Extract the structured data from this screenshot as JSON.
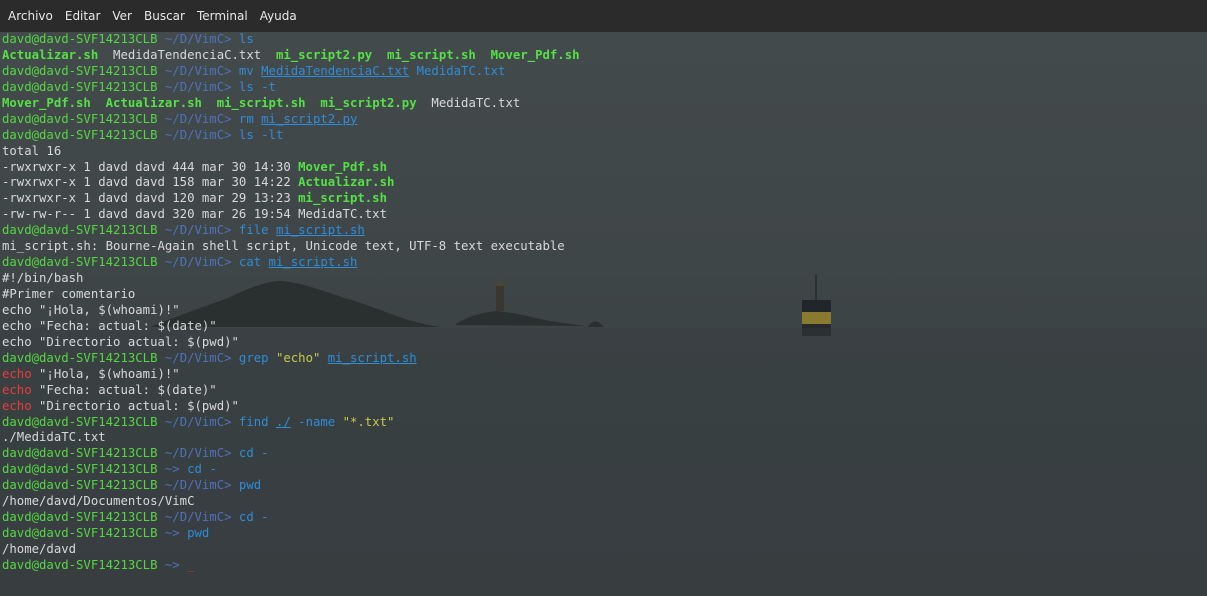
{
  "menubar": {
    "items": [
      "Archivo",
      "Editar",
      "Ver",
      "Buscar",
      "Terminal",
      "Ayuda"
    ]
  },
  "terminal": {
    "lines": [
      [
        {
          "t": "davd@davd-SVF14213CLB",
          "c": "pu"
        },
        {
          "t": " ~/D/VimC> ",
          "c": "pp"
        },
        {
          "t": "ls",
          "c": "cm"
        }
      ],
      [
        {
          "t": "Actualizar.sh",
          "c": "ex"
        },
        {
          "t": "  MedidaTendenciaC.txt  ",
          "c": ""
        },
        {
          "t": "mi_script2.py",
          "c": "ex"
        },
        {
          "t": "  ",
          "c": ""
        },
        {
          "t": "mi_script.sh",
          "c": "ex"
        },
        {
          "t": "  ",
          "c": ""
        },
        {
          "t": "Mover_Pdf.sh",
          "c": "ex"
        }
      ],
      [
        {
          "t": "davd@davd-SVF14213CLB",
          "c": "pu"
        },
        {
          "t": " ~/D/VimC> ",
          "c": "pp"
        },
        {
          "t": "mv ",
          "c": "cm"
        },
        {
          "t": "MedidaTendenciaC.txt",
          "c": "fl"
        },
        {
          "t": " MedidaTC.txt",
          "c": "ar"
        }
      ],
      [
        {
          "t": "davd@davd-SVF14213CLB",
          "c": "pu"
        },
        {
          "t": " ~/D/VimC> ",
          "c": "pp"
        },
        {
          "t": "ls -t",
          "c": "cm"
        }
      ],
      [
        {
          "t": "Mover_Pdf.sh",
          "c": "ex"
        },
        {
          "t": "  ",
          "c": ""
        },
        {
          "t": "Actualizar.sh",
          "c": "ex"
        },
        {
          "t": "  ",
          "c": ""
        },
        {
          "t": "mi_script.sh",
          "c": "ex"
        },
        {
          "t": "  ",
          "c": ""
        },
        {
          "t": "mi_script2.py",
          "c": "ex"
        },
        {
          "t": "  MedidaTC.txt",
          "c": ""
        }
      ],
      [
        {
          "t": "davd@davd-SVF14213CLB",
          "c": "pu"
        },
        {
          "t": " ~/D/VimC> ",
          "c": "pp"
        },
        {
          "t": "rm ",
          "c": "cm"
        },
        {
          "t": "mi_script2.py",
          "c": "fl"
        }
      ],
      [
        {
          "t": "davd@davd-SVF14213CLB",
          "c": "pu"
        },
        {
          "t": " ~/D/VimC> ",
          "c": "pp"
        },
        {
          "t": "ls -lt",
          "c": "cm"
        }
      ],
      [
        {
          "t": "total 16",
          "c": ""
        }
      ],
      [
        {
          "t": "-rwxrwxr-x 1 davd davd 444 mar 30 14:30 ",
          "c": ""
        },
        {
          "t": "Mover_Pdf.sh",
          "c": "ex"
        }
      ],
      [
        {
          "t": "-rwxrwxr-x 1 davd davd 158 mar 30 14:22 ",
          "c": ""
        },
        {
          "t": "Actualizar.sh",
          "c": "ex"
        }
      ],
      [
        {
          "t": "-rwxrwxr-x 1 davd davd 120 mar 29 13:23 ",
          "c": ""
        },
        {
          "t": "mi_script.sh",
          "c": "ex"
        }
      ],
      [
        {
          "t": "-rw-rw-r-- 1 davd davd 320 mar 26 19:54 MedidaTC.txt",
          "c": ""
        }
      ],
      [
        {
          "t": "davd@davd-SVF14213CLB",
          "c": "pu"
        },
        {
          "t": " ~/D/VimC> ",
          "c": "pp"
        },
        {
          "t": "file ",
          "c": "cm"
        },
        {
          "t": "mi_script.sh",
          "c": "fl"
        }
      ],
      [
        {
          "t": "mi_script.sh: Bourne-Again shell script, Unicode text, UTF-8 text executable",
          "c": ""
        }
      ],
      [
        {
          "t": "davd@davd-SVF14213CLB",
          "c": "pu"
        },
        {
          "t": " ~/D/VimC> ",
          "c": "pp"
        },
        {
          "t": "cat ",
          "c": "cm"
        },
        {
          "t": "mi_script.sh",
          "c": "fl"
        }
      ],
      [
        {
          "t": "#!/bin/bash",
          "c": ""
        }
      ],
      [
        {
          "t": "#Primer comentario",
          "c": ""
        }
      ],
      [
        {
          "t": "echo \"¡Hola, $(whoami)!\"",
          "c": ""
        }
      ],
      [
        {
          "t": "echo \"Fecha: actual: $(date)\"",
          "c": ""
        }
      ],
      [
        {
          "t": "echo \"Directorio actual: $(pwd)\"",
          "c": ""
        }
      ],
      [
        {
          "t": "davd@davd-SVF14213CLB",
          "c": "pu"
        },
        {
          "t": " ~/D/VimC> ",
          "c": "pp"
        },
        {
          "t": "grep ",
          "c": "cm"
        },
        {
          "t": "\"echo\"",
          "c": "st"
        },
        {
          "t": " ",
          "c": ""
        },
        {
          "t": "mi_script.sh",
          "c": "fl"
        }
      ],
      [
        {
          "t": "echo",
          "c": "hl"
        },
        {
          "t": " \"¡Hola, $(whoami)!\"",
          "c": ""
        }
      ],
      [
        {
          "t": "echo",
          "c": "hl"
        },
        {
          "t": " \"Fecha: actual: $(date)\"",
          "c": ""
        }
      ],
      [
        {
          "t": "echo",
          "c": "hl"
        },
        {
          "t": " \"Directorio actual: $(pwd)\"",
          "c": ""
        }
      ],
      [
        {
          "t": "davd@davd-SVF14213CLB",
          "c": "pu"
        },
        {
          "t": " ~/D/VimC> ",
          "c": "pp"
        },
        {
          "t": "find ",
          "c": "cm"
        },
        {
          "t": "./",
          "c": "fl"
        },
        {
          "t": " -name ",
          "c": "ar"
        },
        {
          "t": "\"*.txt\"",
          "c": "st"
        }
      ],
      [
        {
          "t": "./MedidaTC.txt",
          "c": ""
        }
      ],
      [
        {
          "t": "davd@davd-SVF14213CLB",
          "c": "pu"
        },
        {
          "t": " ~/D/VimC> ",
          "c": "pp"
        },
        {
          "t": "cd -",
          "c": "cm"
        }
      ],
      [
        {
          "t": "davd@davd-SVF14213CLB",
          "c": "pu"
        },
        {
          "t": " ~> ",
          "c": "pp"
        },
        {
          "t": "cd -",
          "c": "cm"
        }
      ],
      [
        {
          "t": "davd@davd-SVF14213CLB",
          "c": "pu"
        },
        {
          "t": " ~/D/VimC> ",
          "c": "pp"
        },
        {
          "t": "pwd",
          "c": "cm"
        }
      ],
      [
        {
          "t": "/home/davd/Documentos/VimC",
          "c": ""
        }
      ],
      [
        {
          "t": "davd@davd-SVF14213CLB",
          "c": "pu"
        },
        {
          "t": " ~/D/VimC> ",
          "c": "pp"
        },
        {
          "t": "cd -",
          "c": "cm"
        }
      ],
      [
        {
          "t": "davd@davd-SVF14213CLB",
          "c": "pu"
        },
        {
          "t": " ~> ",
          "c": "pp"
        },
        {
          "t": "pwd",
          "c": "cm"
        }
      ],
      [
        {
          "t": "/home/davd",
          "c": ""
        }
      ],
      [
        {
          "t": "davd@davd-SVF14213CLB",
          "c": "pu"
        },
        {
          "t": " ~> ",
          "c": "pp"
        },
        {
          "t": "_",
          "c": "cursor"
        }
      ]
    ]
  },
  "colors": {
    "menubar_bg": "#2b2b2b",
    "terminal_bg": "#3f4648",
    "prompt_user": "#55d642",
    "prompt_path": "#4f72b8",
    "command": "#2f8cd6",
    "executable": "#55e045",
    "grep_match": "#ef3a3a",
    "string": "#c8c84a",
    "cursor": "#d83030"
  }
}
